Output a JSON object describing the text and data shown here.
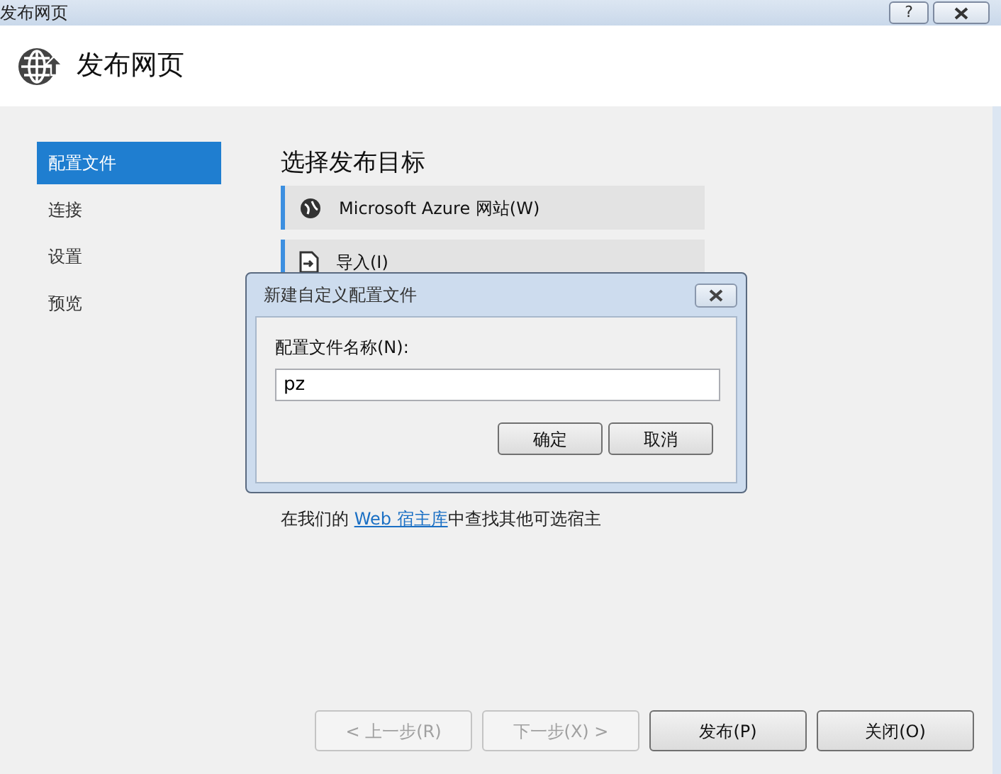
{
  "window": {
    "title": "发布网页",
    "help": "?"
  },
  "header": {
    "title": "发布网页"
  },
  "sidebar": {
    "items": [
      {
        "label": "配置文件",
        "selected": true
      },
      {
        "label": "连接",
        "selected": false
      },
      {
        "label": "设置",
        "selected": false
      },
      {
        "label": "预览",
        "selected": false
      }
    ]
  },
  "content": {
    "heading": "选择发布目标",
    "targets": [
      {
        "label": "Microsoft Azure 网站(W)",
        "kind": "azure"
      },
      {
        "label": "导入(I)",
        "kind": "import"
      }
    ],
    "hint": {
      "before": "在我们的 ",
      "link": "Web 宿主库",
      "after": "中查找其他可选宿主"
    }
  },
  "dialog": {
    "title": "新建自定义配置文件",
    "field_label": "配置文件名称(N):",
    "field_value": "pz",
    "buttons": [
      {
        "label": "确定"
      },
      {
        "label": "取消"
      }
    ]
  },
  "footer": {
    "buttons": [
      {
        "label": "< 上一步(R)",
        "disabled": true
      },
      {
        "label": "下一步(X) >",
        "disabled": true
      },
      {
        "label": "发布(P)",
        "disabled": false
      },
      {
        "label": "关闭(O)",
        "disabled": false
      }
    ]
  }
}
